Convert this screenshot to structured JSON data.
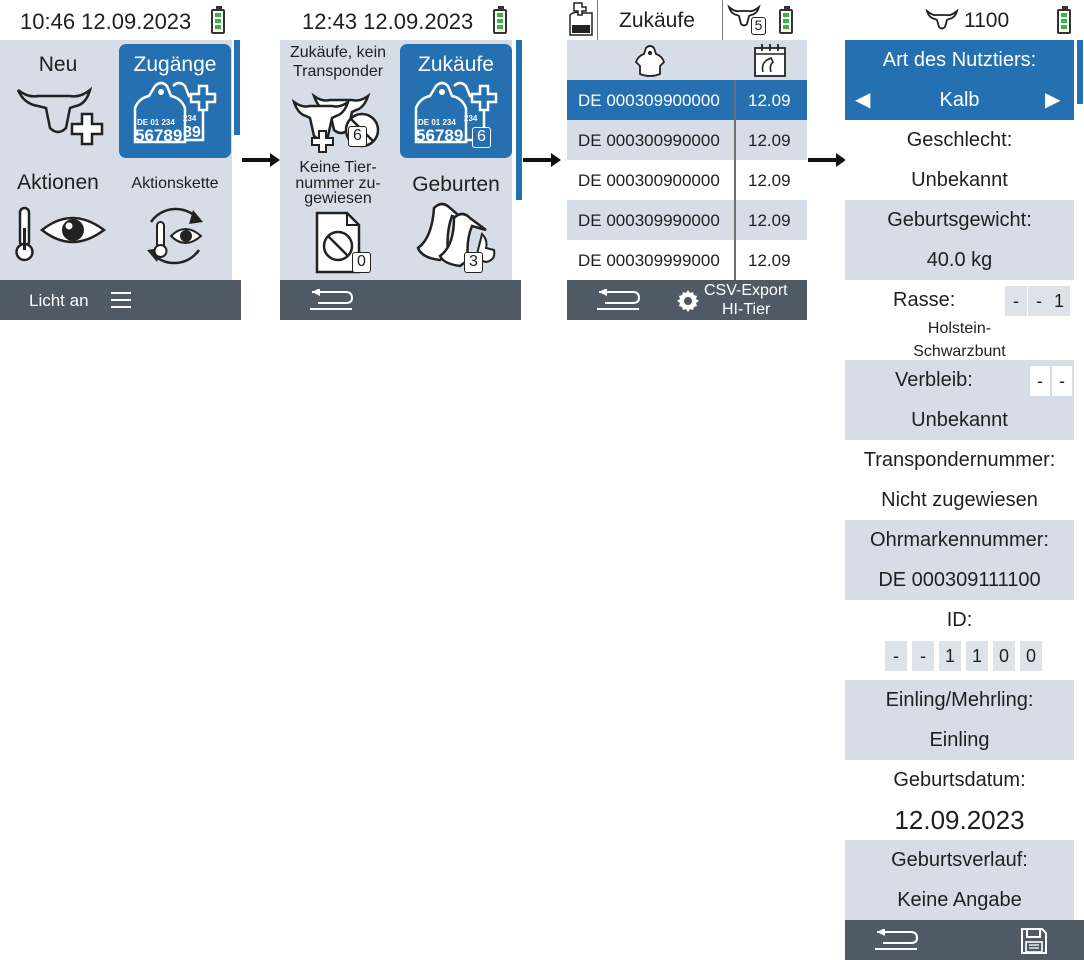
{
  "screen1": {
    "time": "10:46 12.09.2023",
    "tiles": {
      "neu": "Neu",
      "zugaenge": "Zugänge",
      "aktionen": "Aktionen",
      "aktionskette": "Aktionskette"
    },
    "tag_number_top": "DE 01 234",
    "tag_number_main": "56789",
    "tag_number_back_top": "234",
    "tag_number_back_main": "89",
    "bottom_label": "Licht an"
  },
  "screen2": {
    "time": "12:43 12.09.2023",
    "tiles": {
      "zukaeufe_kein_line1": "Zukäufe, kein",
      "zukaeufe_kein_line2": "Transponder",
      "zukaeufe": "Zukäufe",
      "keine_line1": "Keine Tier-",
      "keine_line2": "nummer zu-",
      "keine_line3": "gewiesen",
      "geburten": "Geburten"
    },
    "badges": {
      "zukaeufe_kein": "6",
      "zukaeufe": "6",
      "keine": "0",
      "geburten": "3"
    }
  },
  "screen3": {
    "title": "Zukäufe",
    "header_count": "5",
    "rows": [
      {
        "ear": "DE 000309900000",
        "date": "12.09"
      },
      {
        "ear": "DE 000300990000",
        "date": "12.09"
      },
      {
        "ear": "DE 000300900000",
        "date": "12.09"
      },
      {
        "ear": "DE 000309990000",
        "date": "12.09"
      },
      {
        "ear": "DE 000309999000",
        "date": "12.09"
      }
    ],
    "export_line1": "CSV-Export",
    "export_line2": "HI-Tier"
  },
  "screen4": {
    "animal_id": "1100",
    "art_label": "Art des Nutztiers:",
    "art_value": "Kalb",
    "geschlecht_label": "Geschlecht:",
    "geschlecht_value": "Unbekannt",
    "gewicht_label": "Geburtsgewicht:",
    "gewicht_value": "40.0 kg",
    "rasse_label": "Rasse:",
    "rasse_digits": [
      "-",
      "-",
      "1"
    ],
    "rasse_line1": "Holstein-",
    "rasse_line2": "Schwarzbunt",
    "verbleib_label": "Verbleib:",
    "verbleib_digits": [
      "-",
      "-"
    ],
    "verbleib_value": "Unbekannt",
    "transponder_label": "Transpondernummer:",
    "transponder_value": "Nicht zugewiesen",
    "ohrmarke_label": "Ohrmarkennummer:",
    "ohrmarke_value": "DE 000309111100",
    "id_label": "ID:",
    "id_digits": [
      "-",
      "-",
      "1",
      "1",
      "0",
      "0"
    ],
    "einling_label": "Einling/Mehrling:",
    "einling_value": "Einling",
    "datum_label": "Geburtsdatum:",
    "datum_value": "12.09.2023",
    "verlauf_label": "Geburtsverlauf:",
    "verlauf_value": "Keine Angabe"
  },
  "colors": {
    "accent": "#2570b0",
    "panel": "#d6dde6",
    "bottombar": "#505a64",
    "battery": "#38b63c"
  }
}
